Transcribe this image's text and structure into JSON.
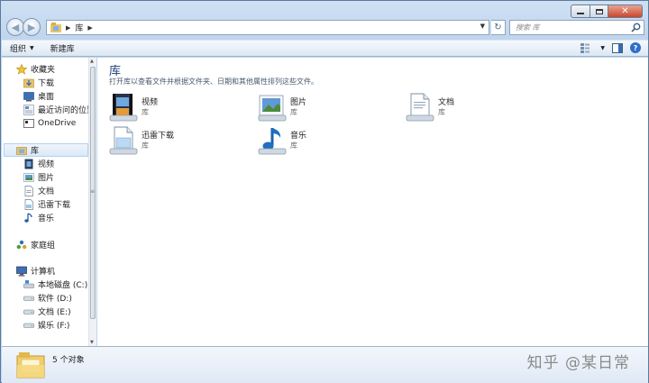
{
  "address": {
    "crumbs": [
      "库"
    ]
  },
  "search": {
    "placeholder": "搜索 库"
  },
  "toolbar": {
    "organize": "组织",
    "new_library": "新建库"
  },
  "nav": {
    "favorites_title": "收藏夹",
    "favorites": [
      "下载",
      "桌面",
      "最近访问的位置",
      "OneDrive"
    ],
    "libraries_title": "库",
    "libraries": [
      "视频",
      "图片",
      "文档",
      "迅雷下载",
      "音乐"
    ],
    "homegroup": "家庭组",
    "computer_title": "计算机",
    "drives": [
      "本地磁盘 (C:)",
      "软件 (D:)",
      "文档 (E:)",
      "娱乐 (F:)"
    ]
  },
  "content": {
    "title": "库",
    "description": "打开库以查看文件并根据文件夹、日期和其他属性排列这些文件。",
    "items": [
      {
        "name": "视频",
        "type": "库",
        "icon": "video-library-icon"
      },
      {
        "name": "图片",
        "type": "库",
        "icon": "pictures-library-icon"
      },
      {
        "name": "文档",
        "type": "库",
        "icon": "documents-library-icon"
      },
      {
        "name": "迅雷下载",
        "type": "库",
        "icon": "download-library-icon"
      },
      {
        "name": "音乐",
        "type": "库",
        "icon": "music-library-icon"
      }
    ]
  },
  "status": {
    "count": "5 个对象"
  },
  "watermark": "知乎 @某日常",
  "colors": {
    "accent": "#1e3c7d",
    "frame": "#c0d6ee",
    "selection": "#dbe9f8"
  }
}
